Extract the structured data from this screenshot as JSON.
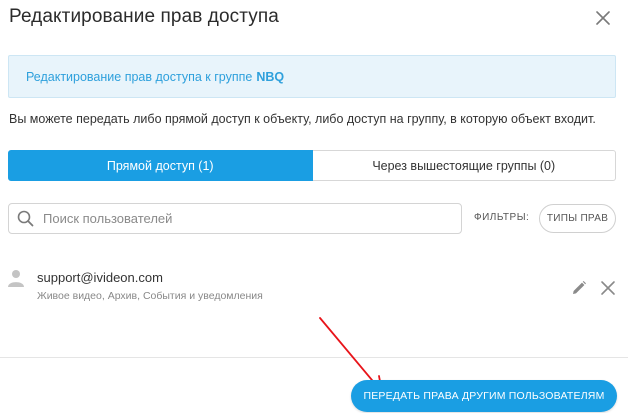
{
  "dialog": {
    "title": "Редактирование прав доступа"
  },
  "info": {
    "text": "Редактирование прав доступа к группе",
    "group_name": "NBQ"
  },
  "description": "Вы можете передать либо прямой доступ к объекту, либо доступ на группу, в которую объект входит.",
  "tabs": [
    {
      "label": "Прямой доступ (1)",
      "active": true
    },
    {
      "label": "Через вышестоящие группы (0)",
      "active": false
    }
  ],
  "search": {
    "placeholder": "Поиск пользователей",
    "value": ""
  },
  "filters": {
    "label": "ФИЛЬТРЫ:",
    "rights_button": "ТИПЫ ПРАВ"
  },
  "users": [
    {
      "email": "support@ivideon.com",
      "permissions": "Живое видео, Архив, События и уведомления"
    }
  ],
  "footer": {
    "share_button": "ПЕРЕДАТЬ ПРАВА ДРУГИМ ПОЛЬЗОВАТЕЛЯМ"
  },
  "colors": {
    "accent": "#1a9ee3",
    "info_text": "#2ea0dc",
    "info_bg": "#e8f4fb",
    "annotation": "#e8141a"
  },
  "icons": {
    "close": "close-icon",
    "search": "search-icon",
    "avatar": "user-icon",
    "edit": "pencil-icon",
    "remove": "remove-icon"
  }
}
